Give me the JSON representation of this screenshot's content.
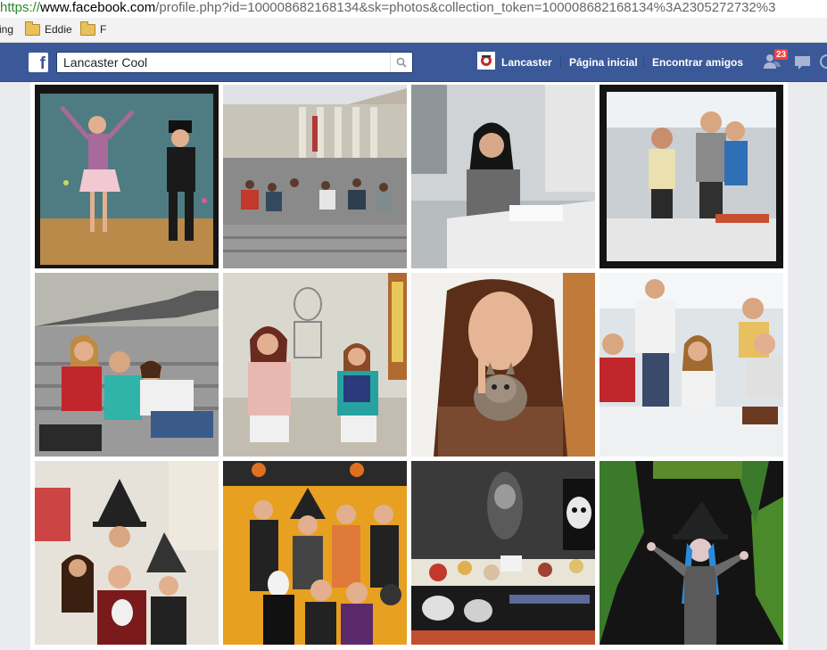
{
  "browser": {
    "url_scheme": "https://",
    "url_host": "www.facebook.com",
    "url_rest": "/profile.php?id=100008682168134&sk=photos&collection_token=100008682168134%3A2305272732%3"
  },
  "bookmarks": {
    "partial_label": "ing",
    "items": [
      {
        "label": "Eddie",
        "icon": "folder-icon"
      },
      {
        "label": "F",
        "icon": "folder-icon"
      }
    ]
  },
  "header": {
    "search_value": "Lancaster Cool",
    "profile_label": "Lancaster",
    "home_label": "Página inicial",
    "find_friends_label": "Encontrar amigos",
    "friend_requests_count": "23",
    "brand_color": "#3b5998",
    "badge_color": "#fa3e3e"
  },
  "photos": [
    {
      "name": "photo-dancing-kids",
      "icon": "photo-thumbnail"
    },
    {
      "name": "photo-museum-steps",
      "icon": "photo-thumbnail"
    },
    {
      "name": "photo-girl-writing",
      "icon": "photo-thumbnail"
    },
    {
      "name": "photo-classroom-boys",
      "icon": "photo-thumbnail"
    },
    {
      "name": "photo-girls-on-stairs",
      "icon": "photo-thumbnail"
    },
    {
      "name": "photo-two-girls-wall",
      "icon": "photo-thumbnail"
    },
    {
      "name": "photo-girl-with-kitten",
      "icon": "photo-thumbnail"
    },
    {
      "name": "photo-group-at-table",
      "icon": "photo-thumbnail"
    },
    {
      "name": "photo-halloween-witches",
      "icon": "photo-thumbnail"
    },
    {
      "name": "photo-halloween-group",
      "icon": "photo-thumbnail"
    },
    {
      "name": "photo-halloween-food-table",
      "icon": "photo-thumbnail"
    },
    {
      "name": "photo-halloween-witch-costume",
      "icon": "photo-thumbnail"
    }
  ]
}
